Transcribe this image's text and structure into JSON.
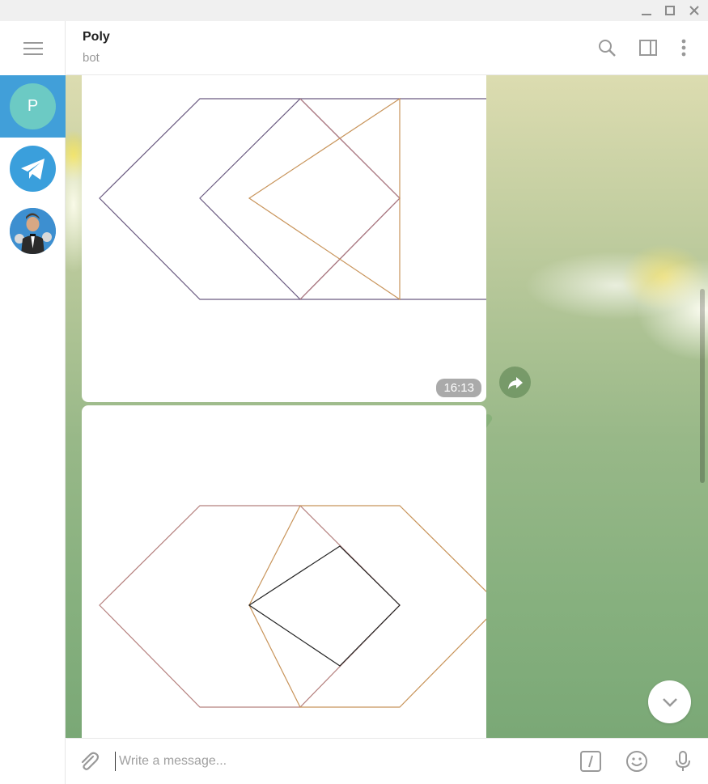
{
  "window": {
    "minimize_glyph": "–",
    "maximize_glyph": "☐",
    "close_glyph": "✕"
  },
  "sidebar": {
    "chats": [
      {
        "initial": "P",
        "active": true
      },
      {
        "icon": "telegram-plane-icon"
      },
      {
        "icon": "person-photo-avatar"
      }
    ]
  },
  "header": {
    "title": "Poly",
    "status": "bot"
  },
  "messages": [
    {
      "type": "photo",
      "time": "16:13"
    },
    {
      "type": "photo",
      "time": ""
    }
  ],
  "composer": {
    "placeholder": "Write a message..."
  },
  "colors": {
    "accent": "#419fd9",
    "avatar_p": "#6ccac4"
  }
}
